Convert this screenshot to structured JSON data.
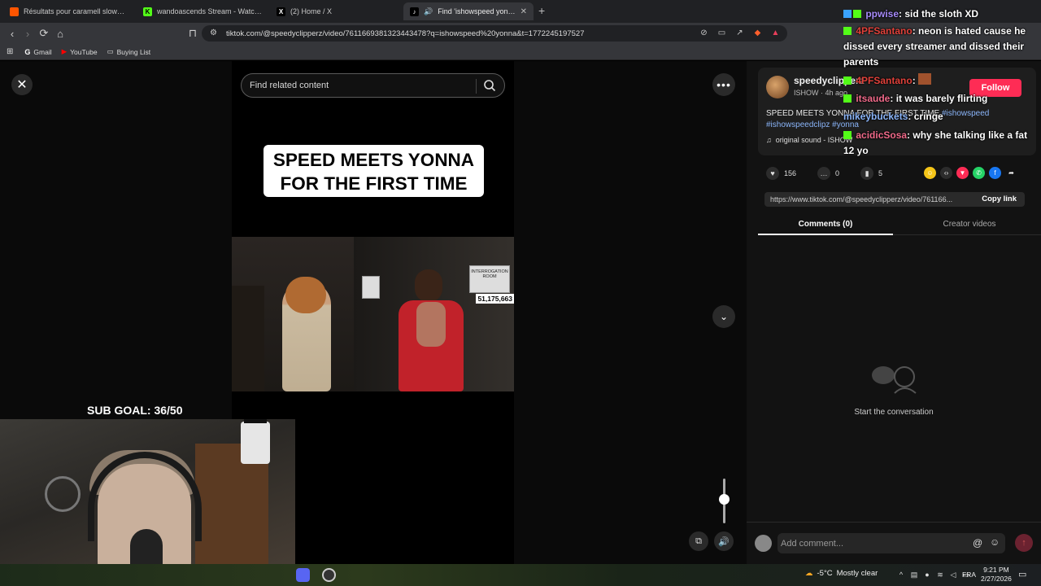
{
  "browser": {
    "tabs": [
      {
        "title": "Résultats pour caramell slowed reve",
        "icon": "soundcloud-icon",
        "color": "#ff5500"
      },
      {
        "title": "wandoascends Stream - Watch Live c",
        "icon": "kick-icon",
        "color": "#53fc18"
      },
      {
        "title": "(2) Home / X",
        "icon": "x-icon",
        "color": "#ffffff"
      },
      {
        "title": "Find 'ishowspeed yonna' on",
        "icon": "tiktok-icon",
        "color": "#ffffff"
      }
    ],
    "url": "tiktok.com/@speedyclipperz/video/7611669381323443478?q=ishowspeed%20yonna&t=1772245197527",
    "bookmarks": [
      {
        "label": "Gmail",
        "icon": "google-icon"
      },
      {
        "label": "YouTube",
        "icon": "youtube-icon"
      },
      {
        "label": "Buying List",
        "icon": "folder-icon"
      }
    ]
  },
  "video": {
    "search_placeholder": "Find related content",
    "caption_line1": "SPEED MEETS YONNA",
    "caption_line2": "FOR THE FIRST TIME",
    "count_sign": "51,175,663",
    "sign_text": "INTERROGATION ROOM",
    "volume_level": 0.55
  },
  "post": {
    "username": "speedyclipperz",
    "meta": "ISHOW · 4h ago",
    "follow_label": "Follow",
    "description": "SPEED MEETS YONNA FOR THE FIRST TIME",
    "hashtags": [
      "#ishowspeed",
      "#ishowspeedclipz",
      "#yonna"
    ],
    "sound": "original sound - ISHOW",
    "likes": "156",
    "comments": "0",
    "saves": "5",
    "link": "https://www.tiktok.com/@speedyclipperz/video/761166...",
    "copy_link_label": "Copy link",
    "tab_comments": "Comments (0)",
    "tab_creator": "Creator videos",
    "empty_text": "Start the conversation",
    "comment_placeholder": "Add comment...",
    "accent": "#fe2c55"
  },
  "stream": {
    "sub_goal": "SUB GOAL: 36/50",
    "chat": [
      {
        "user": "ppwise",
        "text": ": sid the sloth XD"
      },
      {
        "user": "4PFSantano",
        "text": ": neon is hated cause he dissed every streamer and dissed their parents"
      },
      {
        "user": "4PFSantano",
        "text": ":"
      },
      {
        "user": "itsaude",
        "text": ": it was barely flirting"
      },
      {
        "user": "mikeybuckets",
        "text": ": cringe"
      },
      {
        "user": "acidicSosa",
        "text": ": why she talking like a fat 12 yo"
      }
    ]
  },
  "taskbar": {
    "temperature": "-5°C",
    "weather": "Mostly clear",
    "lang": "FRA",
    "time": "9:21 PM",
    "date": "2/27/2026"
  }
}
